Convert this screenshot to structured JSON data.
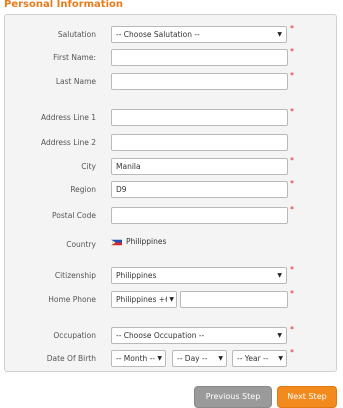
{
  "section": {
    "title": "Personal Information"
  },
  "form": {
    "salutation": {
      "label": "Salutation",
      "value": "-- Choose Salutation --"
    },
    "first_name": {
      "label": "First Name:",
      "value": ""
    },
    "last_name": {
      "label": "Last Name",
      "value": ""
    },
    "address1": {
      "label": "Address Line 1",
      "value": ""
    },
    "address2": {
      "label": "Address Line 2",
      "value": ""
    },
    "city": {
      "label": "City",
      "value": "Manila"
    },
    "region": {
      "label": "Region",
      "value": "D9"
    },
    "postal_code": {
      "label": "Postal Code",
      "value": ""
    },
    "country": {
      "label": "Country",
      "value": "Philippines",
      "icon": "philippines-flag-icon"
    },
    "citizenship": {
      "label": "Citizenship",
      "value": "Philippines"
    },
    "home_phone": {
      "label": "Home Phone",
      "code_value": "Philippines +6",
      "number_value": ""
    },
    "occupation": {
      "label": "Occupation",
      "value": "-- Choose Occupation --"
    },
    "dob": {
      "label": "Date Of Birth",
      "month": "-- Month --",
      "day": "-- Day --",
      "year": "-- Year --"
    },
    "required_mark": "*"
  },
  "buttons": {
    "previous": "Previous Step",
    "next": "Next Step"
  },
  "colors": {
    "accent": "#e87b1c",
    "required": "#e02424",
    "next_button": "#f28a1e",
    "previous_button": "#9a9a9a"
  }
}
